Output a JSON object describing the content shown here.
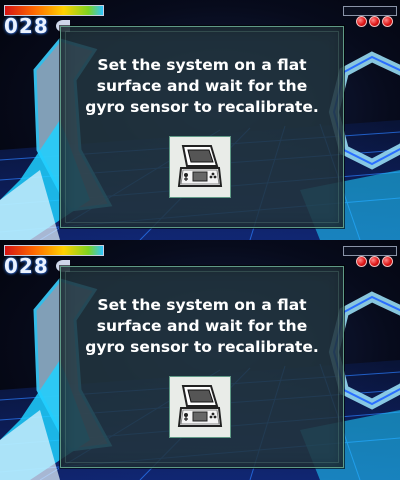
{
  "hud": {
    "health_fraction": 1.0,
    "score": "028",
    "bombs": 3
  },
  "dialog": {
    "line1": "Set the system on a flat",
    "line2": "surface and wait for the",
    "line3": "gyro sensor to recalibrate.",
    "icon": "3ds-console-icon"
  },
  "colors": {
    "panel": "#22343e",
    "panel_border": "#5f9a86",
    "grid": "#1e8cff",
    "bomb": "#e01818"
  }
}
